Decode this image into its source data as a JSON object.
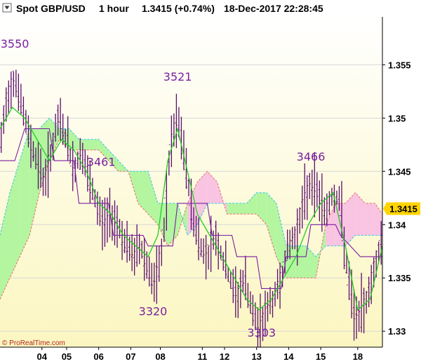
{
  "header": {
    "instrument": "Spot GBP/USD",
    "timeframe": "1 hour",
    "quote": "1.3415 (+0.74%)",
    "datetime": "18-Dec-2017 22:28:45"
  },
  "copyright": "© ProRealTime.com",
  "colors": {
    "bullish_cloud": "#b4f5a0",
    "bearish_cloud": "#f8c4e2",
    "price": "#5a0f6e",
    "tenkan": "#22cc22",
    "kijun": "#7a1fa0",
    "last_price_box": "#ffd400",
    "bg_top": "#ffffff",
    "bg_bottom": "#fbf7c4"
  },
  "chart_data": {
    "type": "line",
    "subtype": "ichimoku-ohlc",
    "ylim": [
      1.3285,
      1.3595
    ],
    "yticks": [
      {
        "value": 1.355,
        "label": "1.355"
      },
      {
        "value": 1.35,
        "label": "1.35"
      },
      {
        "value": 1.345,
        "label": "1.345"
      },
      {
        "value": 1.34,
        "label": "1.34"
      },
      {
        "value": 1.335,
        "label": "1.335"
      },
      {
        "value": 1.33,
        "label": "1.33"
      }
    ],
    "xlim": [
      0,
      155
    ],
    "xticks": [
      {
        "x": 17,
        "label": "04"
      },
      {
        "x": 27,
        "label": "05"
      },
      {
        "x": 40,
        "label": "06"
      },
      {
        "x": 53,
        "label": "07"
      },
      {
        "x": 65,
        "label": "08"
      },
      {
        "x": 82,
        "label": "11"
      },
      {
        "x": 91,
        "label": "12"
      },
      {
        "x": 104,
        "label": "13"
      },
      {
        "x": 117,
        "label": "14"
      },
      {
        "x": 130,
        "label": "15"
      },
      {
        "x": 145,
        "label": "18"
      }
    ],
    "last_price": {
      "value": 1.3415,
      "label": "1.3415"
    },
    "annotations": [
      {
        "x": 6,
        "y": 1.3566,
        "text": "3550"
      },
      {
        "x": 41,
        "y": 1.3455,
        "text": "3461"
      },
      {
        "x": 72,
        "y": 1.3535,
        "text": "3521"
      },
      {
        "x": 126,
        "y": 1.346,
        "text": "3466"
      },
      {
        "x": 62,
        "y": 1.3315,
        "text": "3320"
      },
      {
        "x": 106,
        "y": 1.3295,
        "text": "3303"
      }
    ],
    "price_knots": [
      [
        0,
        1.347
      ],
      [
        3,
        1.352
      ],
      [
        6,
        1.354
      ],
      [
        9,
        1.351
      ],
      [
        12,
        1.348
      ],
      [
        15,
        1.346
      ],
      [
        18,
        1.344
      ],
      [
        21,
        1.347
      ],
      [
        24,
        1.35
      ],
      [
        27,
        1.348
      ],
      [
        30,
        1.345
      ],
      [
        33,
        1.347
      ],
      [
        36,
        1.344
      ],
      [
        39,
        1.342
      ],
      [
        42,
        1.34
      ],
      [
        45,
        1.341
      ],
      [
        48,
        1.34
      ],
      [
        51,
        1.338
      ],
      [
        54,
        1.337
      ],
      [
        57,
        1.338
      ],
      [
        60,
        1.336
      ],
      [
        63,
        1.334
      ],
      [
        66,
        1.338
      ],
      [
        69,
        1.347
      ],
      [
        72,
        1.35
      ],
      [
        75,
        1.346
      ],
      [
        78,
        1.341
      ],
      [
        81,
        1.338
      ],
      [
        84,
        1.337
      ],
      [
        87,
        1.339
      ],
      [
        90,
        1.337
      ],
      [
        93,
        1.335
      ],
      [
        96,
        1.333
      ],
      [
        99,
        1.335
      ],
      [
        102,
        1.332
      ],
      [
        105,
        1.33
      ],
      [
        108,
        1.332
      ],
      [
        111,
        1.333
      ],
      [
        114,
        1.335
      ],
      [
        117,
        1.338
      ],
      [
        120,
        1.339
      ],
      [
        123,
        1.342
      ],
      [
        126,
        1.344
      ],
      [
        129,
        1.343
      ],
      [
        132,
        1.341
      ],
      [
        135,
        1.343
      ],
      [
        138,
        1.342
      ],
      [
        141,
        1.335
      ],
      [
        144,
        1.331
      ],
      [
        147,
        1.332
      ],
      [
        150,
        1.334
      ],
      [
        153,
        1.337
      ],
      [
        155,
        1.339
      ]
    ],
    "tenkan_knots": [
      [
        0,
        1.349
      ],
      [
        5,
        1.351
      ],
      [
        10,
        1.35
      ],
      [
        15,
        1.348
      ],
      [
        20,
        1.346
      ],
      [
        25,
        1.348
      ],
      [
        30,
        1.347
      ],
      [
        35,
        1.345
      ],
      [
        40,
        1.342
      ],
      [
        45,
        1.341
      ],
      [
        50,
        1.339
      ],
      [
        55,
        1.338
      ],
      [
        60,
        1.337
      ],
      [
        64,
        1.339
      ],
      [
        68,
        1.346
      ],
      [
        72,
        1.349
      ],
      [
        76,
        1.345
      ],
      [
        80,
        1.341
      ],
      [
        85,
        1.339
      ],
      [
        90,
        1.337
      ],
      [
        95,
        1.335
      ],
      [
        100,
        1.333
      ],
      [
        105,
        1.332
      ],
      [
        110,
        1.333
      ],
      [
        115,
        1.335
      ],
      [
        120,
        1.337
      ],
      [
        125,
        1.34
      ],
      [
        130,
        1.342
      ],
      [
        135,
        1.343
      ],
      [
        140,
        1.338
      ],
      [
        145,
        1.332
      ],
      [
        150,
        1.333
      ],
      [
        155,
        1.338
      ]
    ],
    "kijun_knots": [
      [
        0,
        1.346
      ],
      [
        6,
        1.346
      ],
      [
        10,
        1.349
      ],
      [
        20,
        1.349
      ],
      [
        22,
        1.346
      ],
      [
        30,
        1.346
      ],
      [
        32,
        1.342
      ],
      [
        44,
        1.342
      ],
      [
        46,
        1.339
      ],
      [
        58,
        1.339
      ],
      [
        60,
        1.338
      ],
      [
        70,
        1.338
      ],
      [
        72,
        1.342
      ],
      [
        84,
        1.342
      ],
      [
        86,
        1.339
      ],
      [
        94,
        1.339
      ],
      [
        96,
        1.337
      ],
      [
        104,
        1.337
      ],
      [
        106,
        1.334
      ],
      [
        114,
        1.334
      ],
      [
        116,
        1.337
      ],
      [
        124,
        1.337
      ],
      [
        126,
        1.34
      ],
      [
        136,
        1.34
      ],
      [
        138,
        1.339
      ],
      [
        146,
        1.337
      ],
      [
        155,
        1.337
      ]
    ],
    "cloud": [
      [
        0,
        1.339,
        1.333
      ],
      [
        4,
        1.343,
        1.335
      ],
      [
        8,
        1.346,
        1.337
      ],
      [
        12,
        1.349,
        1.339
      ],
      [
        16,
        1.349,
        1.343
      ],
      [
        20,
        1.35,
        1.346
      ],
      [
        24,
        1.349,
        1.348
      ],
      [
        28,
        1.349,
        1.347
      ],
      [
        32,
        1.348,
        1.347
      ],
      [
        36,
        1.348,
        1.347
      ],
      [
        40,
        1.348,
        1.347
      ],
      [
        44,
        1.347,
        1.346
      ],
      [
        48,
        1.346,
        1.345
      ],
      [
        52,
        1.345,
        1.345
      ],
      [
        56,
        1.345,
        1.342
      ],
      [
        60,
        1.345,
        1.341
      ],
      [
        64,
        1.342,
        1.34
      ],
      [
        68,
        1.342,
        1.338
      ],
      [
        72,
        1.342,
        1.339
      ],
      [
        76,
        1.339,
        1.342
      ],
      [
        80,
        1.34,
        1.344
      ],
      [
        84,
        1.342,
        1.345
      ],
      [
        88,
        1.342,
        1.344
      ],
      [
        92,
        1.342,
        1.341
      ],
      [
        96,
        1.342,
        1.341
      ],
      [
        100,
        1.342,
        1.341
      ],
      [
        104,
        1.343,
        1.341
      ],
      [
        108,
        1.343,
        1.34
      ],
      [
        112,
        1.342,
        1.337
      ],
      [
        116,
        1.338,
        1.335
      ],
      [
        120,
        1.338,
        1.335
      ],
      [
        124,
        1.338,
        1.335
      ],
      [
        128,
        1.337,
        1.335
      ],
      [
        132,
        1.338,
        1.34
      ],
      [
        136,
        1.338,
        1.342
      ],
      [
        140,
        1.338,
        1.342
      ],
      [
        144,
        1.339,
        1.343
      ],
      [
        148,
        1.339,
        1.342
      ],
      [
        152,
        1.339,
        1.342
      ],
      [
        155,
        1.339,
        1.341
      ]
    ]
  }
}
